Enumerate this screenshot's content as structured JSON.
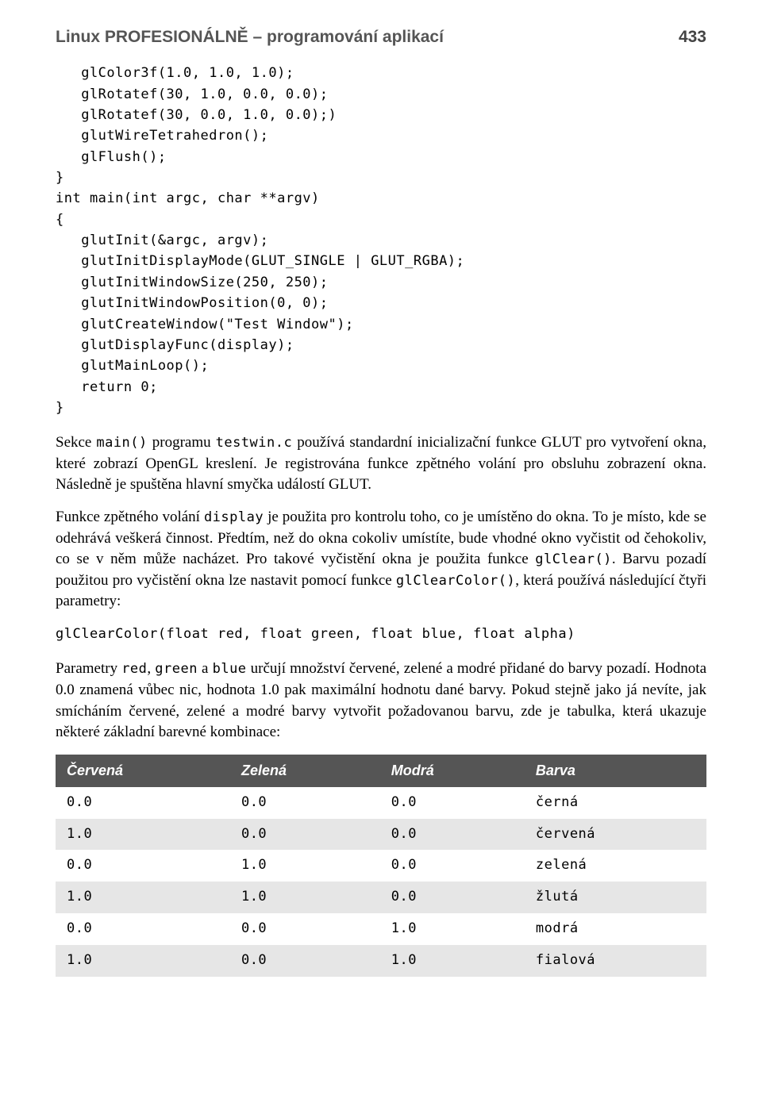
{
  "header": {
    "title": "Linux PROFESIONÁLNĚ – programování aplikací",
    "page_number": "433"
  },
  "code_block1": "   glColor3f(1.0, 1.0, 1.0);\n   glRotatef(30, 1.0, 0.0, 0.0);\n   glRotatef(30, 0.0, 1.0, 0.0);)\n   glutWireTetrahedron();\n   glFlush();\n}\nint main(int argc, char **argv)\n{\n   glutInit(&argc, argv);\n   glutInitDisplayMode(GLUT_SINGLE | GLUT_RGBA);\n   glutInitWindowSize(250, 250);\n   glutInitWindowPosition(0, 0);\n   glutCreateWindow(\"Test Window\");\n   glutDisplayFunc(display);\n   glutMainLoop();\n   return 0;\n}",
  "para1": {
    "pre1": "Sekce ",
    "code1": "main()",
    "mid1": " programu ",
    "code2": "testwin.c",
    "post1": " používá standardní inicializační funkce GLUT pro vytvoření okna, které zobrazí OpenGL kreslení. Je registrována funkce zpětného volání pro obsluhu zobrazení okna. Následně je spuštěna hlavní smyčka událostí GLUT."
  },
  "para2": {
    "pre": "Funkce zpětného volání ",
    "code1": "display",
    "mid": " je použita pro kontrolu toho, co je umístěno do okna. To je místo, kde se odehrává veškerá činnost. Předtím, než do okna cokoliv umístíte, bude vhodné okno vyčistit od čehokoliv, co se v něm může nacházet. Pro takové vyčistění okna je použita funkce ",
    "code2": "glClear()",
    "post": ". Barvu pozadí použitou pro vyčistění okna lze nastavit pomocí funkce ",
    "code3": "glClearColor()",
    "tail": ", která používá následující čtyři parametry:"
  },
  "code_line": "glClearColor(float red, float green, float blue, float alpha)",
  "para3": {
    "pre": "Parametry ",
    "code1": "red",
    "sep1": ", ",
    "code2": "green",
    "sep2": " a ",
    "code3": "blue",
    "post": " určují množství červené, zelené a modré přidané do barvy pozadí. Hodnota 0.0 znamená vůbec nic, hodnota 1.0 pak maximální hodnotu dané barvy. Pokud stejně jako já nevíte, jak smícháním červené, zelené a modré barvy vytvořit požadovanou barvu, zde je tabulka, která ukazuje některé základní barevné kombinace:"
  },
  "table": {
    "headers": [
      "Červená",
      "Zelená",
      "Modrá",
      "Barva"
    ],
    "rows": [
      [
        "0.0",
        "0.0",
        "0.0",
        "černá"
      ],
      [
        "1.0",
        "0.0",
        "0.0",
        "červená"
      ],
      [
        "0.0",
        "1.0",
        "0.0",
        "zelená"
      ],
      [
        "1.0",
        "1.0",
        "0.0",
        "žlutá"
      ],
      [
        "0.0",
        "0.0",
        "1.0",
        "modrá"
      ],
      [
        "1.0",
        "0.0",
        "1.0",
        "fialová"
      ]
    ]
  }
}
